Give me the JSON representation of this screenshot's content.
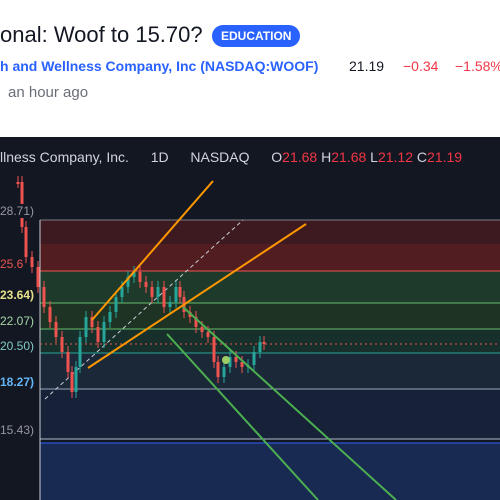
{
  "idea": {
    "title": "onal: Woof to 15.70?",
    "badge": "EDUCATION",
    "symbol_line": "h and Wellness Company, Inc (NASDAQ:WOOF)",
    "last_price": "21.19",
    "change": "−0.34",
    "change_pct": "−1.58%",
    "published": "an hour ago"
  },
  "chart": {
    "legend_name": "llness Company, Inc.",
    "interval": "1D",
    "exchange": "NASDAQ",
    "ohlc": [
      {
        "k": "O",
        "v": "21.68"
      },
      {
        "k": "H",
        "v": "21.68"
      },
      {
        "k": "L",
        "v": "21.12"
      },
      {
        "k": "C",
        "v": "21.19"
      }
    ],
    "fib_labels": [
      "28.71)",
      "25.6",
      "23.64)",
      "22.07)",
      "20.50)",
      "18.27)",
      "15.43)"
    ],
    "colors": {
      "background": "#131722",
      "up": "#26a69a",
      "down": "#ef5350",
      "trend_orange": "#ff9800",
      "channel_green": "#4caf50",
      "accent": "#2962ff",
      "negative": "#f23645"
    }
  }
}
